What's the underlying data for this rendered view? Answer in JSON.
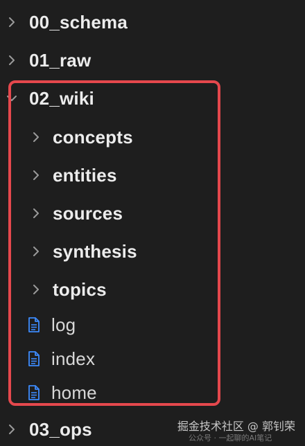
{
  "explorer": {
    "items": [
      {
        "label": "00_schema",
        "type": "folder",
        "expanded": false
      },
      {
        "label": "01_raw",
        "type": "folder",
        "expanded": false
      },
      {
        "label": "02_wiki",
        "type": "folder",
        "expanded": true
      },
      {
        "label": "concepts",
        "type": "folder",
        "expanded": false
      },
      {
        "label": "entities",
        "type": "folder",
        "expanded": false
      },
      {
        "label": "sources",
        "type": "folder",
        "expanded": false
      },
      {
        "label": "synthesis",
        "type": "folder",
        "expanded": false
      },
      {
        "label": "topics",
        "type": "folder",
        "expanded": false
      },
      {
        "label": "log",
        "type": "file"
      },
      {
        "label": "index",
        "type": "file"
      },
      {
        "label": "home",
        "type": "file"
      },
      {
        "label": "03_ops",
        "type": "folder",
        "expanded": false
      }
    ]
  },
  "highlight_color": "#e5484d",
  "watermark": {
    "text": "掘金技术社区 @ 郭钊荣",
    "subtext": "公众号 · 一起聊的AI笔记"
  }
}
